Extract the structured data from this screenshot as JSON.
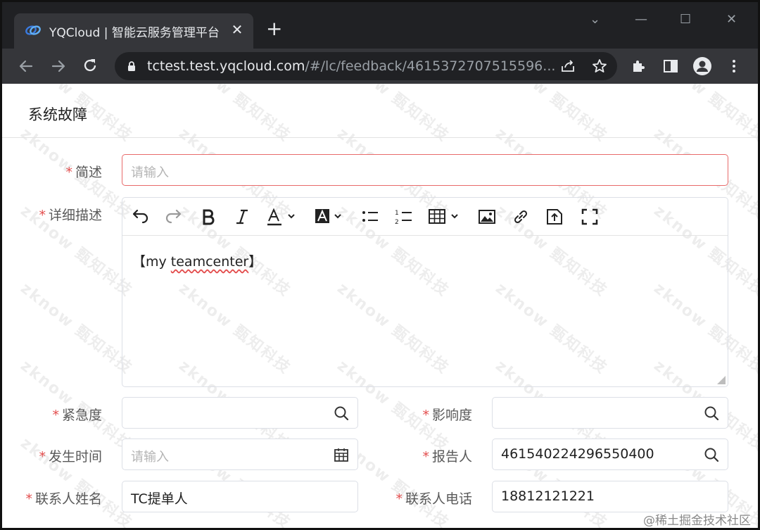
{
  "browser": {
    "tab_title": "YQCloud | 智能云服务管理平台",
    "tab_close": "✕",
    "new_tab": "+",
    "window_controls": [
      "⌄",
      "—",
      "☐",
      "✕"
    ],
    "url_host": "tctest.test.yqcloud.com",
    "url_path": "/#/lc/feedback/4615372707515596..."
  },
  "page": {
    "title": "系统故障"
  },
  "form": {
    "required_mark": "*",
    "summary": {
      "label": "简述",
      "placeholder": "请输入"
    },
    "description": {
      "label": "详细描述",
      "content_prefix": "【my ",
      "content_misspelled": "teamcenter",
      "content_suffix": "】"
    },
    "urgency": {
      "label": "紧急度",
      "value": ""
    },
    "impact": {
      "label": "影响度",
      "value": ""
    },
    "occur_time": {
      "label": "发生时间",
      "placeholder": "请输入"
    },
    "reporter": {
      "label": "报告人",
      "value": "461540224296550400"
    },
    "contact_name": {
      "label": "联系人姓名",
      "value": "TC提单人"
    },
    "contact_phone": {
      "label": "联系人电话",
      "value": "18812121221"
    }
  },
  "editor_toolbar": [
    "undo-icon",
    "redo-icon",
    "bold-icon",
    "italic-icon",
    "font-color-icon",
    "bg-color-icon",
    "bullet-list-icon",
    "numbered-list-icon",
    "table-icon",
    "image-icon",
    "link-icon",
    "upload-icon",
    "fullscreen-icon"
  ],
  "watermark_text": "zknow 甄知科技",
  "credit": "@稀土掘金技术社区",
  "colors": {
    "required": "#e34d4d",
    "error_border": "#e86a6a",
    "chrome_dark": "#202124",
    "chrome_toolbar": "#35363a"
  }
}
